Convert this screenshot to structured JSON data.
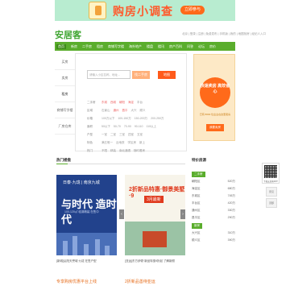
{
  "banner": {
    "title": "购房小调查",
    "button": "立即参与"
  },
  "header": {
    "logo": "安居客",
    "links": "北京 | 登录 | 注册 | 免费发布 | 手机版 | 我的 | 地图找房 | 经纪人入口"
  },
  "nav": {
    "items": [
      "首页",
      "新房",
      "二手房",
      "租房",
      "商铺写字楼",
      "海外地产",
      "楼盘",
      "楼讯",
      "房产百科",
      "问答",
      "论坛",
      "房价"
    ]
  },
  "sidemenu": {
    "items": [
      "买房",
      "卖房",
      "租房",
      "商铺写字楼",
      "厂房仓库"
    ]
  },
  "search": {
    "placeholder": "请输入小区名称、地址...",
    "button": "找二手房",
    "map_button": "地图"
  },
  "filters": [
    {
      "label": "二手房",
      "values": [
        "东城",
        "西城",
        "朝阳",
        "海淀",
        "丰台"
      ]
    },
    {
      "label": "区域",
      "values": [
        "石景山",
        "通州",
        "昌平",
        "大兴",
        "顺义"
      ]
    },
    {
      "label": "价格",
      "values": [
        "100万以下",
        "100-150万",
        "150-200万",
        "200-250万"
      ]
    },
    {
      "label": "面积",
      "values": [
        "50以下",
        "50-70",
        "70-90",
        "90-110",
        "110以上"
      ]
    },
    {
      "label": "户型",
      "values": [
        "一室",
        "二室",
        "三室",
        "四室",
        "五室"
      ]
    },
    {
      "label": "特色",
      "values": [
        "满五唯一",
        "近地铁",
        "学区房",
        "新上"
      ]
    },
    {
      "label": "热门",
      "values": [
        "不限",
        "精装",
        "南北通透",
        "随时看房"
      ]
    }
  ],
  "promo": {
    "title": "快速卖房 高效省心",
    "sub": "已有 8600 位业主在这里卖房",
    "button": "我要卖房"
  },
  "recommend": {
    "title": "热门楼盘",
    "card1": {
      "brand": "日泰·九珑 | 南京九城",
      "headline": "与时代 造时代",
      "tagline": "100-120㎡ 临湖精装 在售中"
    },
    "card2": {
      "headline": "2折新品特惠·御景美墅·9",
      "badge": "3月最新",
      "caption": "[亚运]东方伊顿·新品优惠特惠9折起"
    },
    "caption1": "[新城]弘阳天誉城·九珑 在售户型",
    "caption2": "[亚运]东方伊顿·新品特惠9折起 了解新颜",
    "link1": "专享购房优惠平台上线",
    "link2": "2折新品善待亚运"
  },
  "rightlist": {
    "title": "特价房源",
    "tag": "二手房",
    "items": [
      {
        "name": "朝阳区",
        "price": "520万"
      },
      {
        "name": "海淀区",
        "price": "680万"
      },
      {
        "name": "东城区",
        "price": "745万"
      },
      {
        "name": "丰台区",
        "price": "420万"
      },
      {
        "name": "通州区",
        "price": "330万"
      },
      {
        "name": "昌平区",
        "price": "290万"
      }
    ],
    "tag2": "新房",
    "items2": [
      {
        "name": "大兴区",
        "price": "310万"
      },
      {
        "name": "顺义区",
        "price": "390万"
      }
    ]
  },
  "qr": {
    "caption": "下载安居客APP"
  },
  "side": {
    "buttons": [
      "意见",
      "顶部"
    ]
  }
}
